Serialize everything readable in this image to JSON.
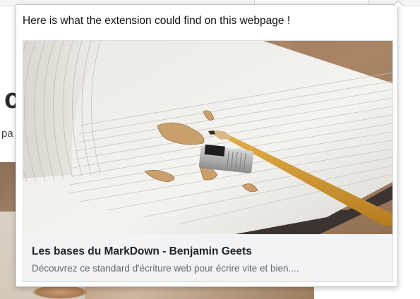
{
  "popup": {
    "message": "Here is what the extension could find on this webpage !"
  },
  "card": {
    "image_icon": "notebook-with-pencil-photo",
    "title": "Les bases du MarkDown - Benjamin Geets",
    "description": "Découvrez ce standard d'écriture web pour écrire vite et bien...."
  },
  "background_page": {
    "heading_fragment": "c",
    "subtext_fragment": "pa"
  },
  "colors": {
    "card_background": "#f2f3f5",
    "card_title": "#1d2129",
    "card_description": "#606770",
    "popup_border": "#c9c9c9"
  }
}
